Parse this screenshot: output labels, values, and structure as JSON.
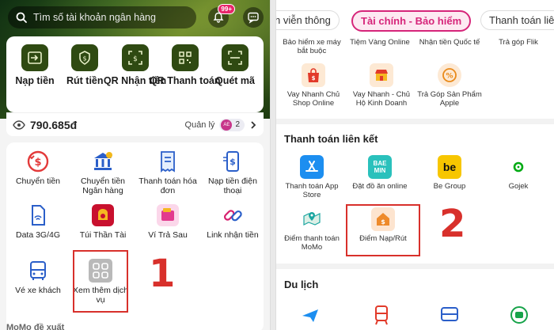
{
  "left": {
    "search": {
      "placeholder": "Tìm số tài khoản ngân hàng"
    },
    "notif_badge": "99+",
    "quick_actions": [
      {
        "label": "Nạp tiền",
        "icon": "deposit-icon"
      },
      {
        "label": "Rút tiền",
        "icon": "withdraw-icon"
      },
      {
        "label": "QR Nhận tiền",
        "icon": "qr-receive-icon"
      },
      {
        "label": "QR Thanh toán",
        "icon": "qr-pay-icon"
      },
      {
        "label": "Quét mã",
        "icon": "scan-icon"
      }
    ],
    "balance": "790.685đ",
    "manage_label": "Quản lý",
    "manage_chip_text": "AE",
    "manage_count": "2",
    "services": [
      {
        "label": "Chuyển tiền",
        "icon": "transfer-icon"
      },
      {
        "label": "Chuyển tiền Ngân hàng",
        "icon": "bank-icon"
      },
      {
        "label": "Thanh toán hóa đơn",
        "icon": "bill-icon"
      },
      {
        "label": "Nạp tiền điện thoại",
        "icon": "phone-topup-icon"
      },
      {
        "label": "Data 3G/4G",
        "icon": "data-sim-icon"
      },
      {
        "label": "Túi Thần Tài",
        "icon": "wealth-bag-icon"
      },
      {
        "label": "Ví Trả Sau",
        "icon": "paylater-wallet-icon"
      },
      {
        "label": "Link nhận tiền",
        "icon": "link-icon"
      },
      {
        "label": "Vé xe khách",
        "icon": "bus-icon"
      },
      {
        "label": "Xem thêm dịch vụ",
        "icon": "more-services-icon"
      }
    ],
    "step_number": "1",
    "footer_text": "MoMo đề xuất"
  },
  "right": {
    "tabs": [
      {
        "label": "h viễn thông"
      },
      {
        "label": "Tài chính - Bảo hiểm",
        "active": true
      },
      {
        "label": "Thanh toán liên"
      }
    ],
    "finance_items": [
      {
        "label": "Bảo hiểm xe máy bắt buộc"
      },
      {
        "label": "Tiệm Vàng Online"
      },
      {
        "label": "Nhận tiền Quốc tế"
      },
      {
        "label": "Trả góp Flik"
      },
      {
        "label": "Vay Nhanh Chủ Shop Online",
        "icon": "loan-shop-icon"
      },
      {
        "label": "Vay Nhanh - Chủ Hộ Kinh Doanh",
        "icon": "loan-business-icon"
      },
      {
        "label": "Trả Góp Sản Phẩm Apple",
        "icon": "installment-icon"
      }
    ],
    "linked_title": "Thanh toán liên kết",
    "linked_items": [
      {
        "label": "Thanh toán App Store",
        "icon": "app-store-icon"
      },
      {
        "label": "Đặt đồ ăn online",
        "icon": "baemin-icon",
        "logo_text": "BAE MIN"
      },
      {
        "label": "Be Group",
        "icon": "be-icon",
        "logo_text": "be"
      },
      {
        "label": "Gojek",
        "icon": "gojek-icon"
      },
      {
        "label": "Điểm thanh toán MoMo",
        "icon": "map-pin-icon"
      },
      {
        "label": "Điểm Nạp/Rút",
        "icon": "cash-point-icon"
      }
    ],
    "step_number": "2",
    "travel_title": "Du lịch"
  }
}
